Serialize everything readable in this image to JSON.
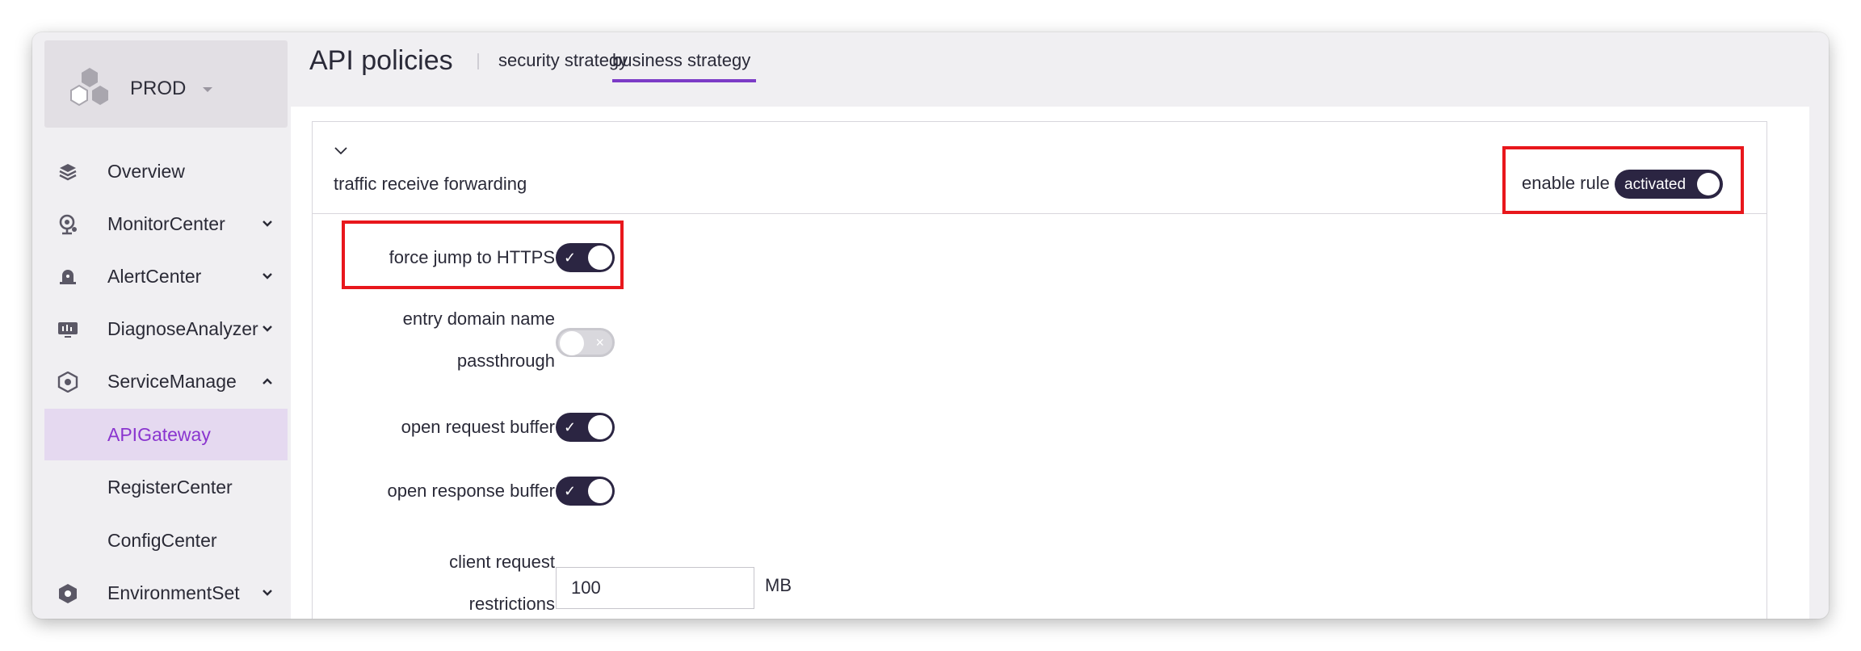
{
  "sidebar": {
    "env_name": "PROD",
    "items": [
      {
        "label": "Overview",
        "icon": "layers-icon"
      },
      {
        "label": "MonitorCenter",
        "icon": "monitor-camera-icon"
      },
      {
        "label": "AlertCenter",
        "icon": "alarm-bell-icon"
      },
      {
        "label": "DiagnoseAnalyzer",
        "icon": "analyzer-screen-icon"
      },
      {
        "label": "ServiceManage",
        "icon": "service-hex-icon"
      },
      {
        "label": "APIGateway"
      },
      {
        "label": "RegisterCenter"
      },
      {
        "label": "ConfigCenter"
      },
      {
        "label": "EnvironmentSet",
        "icon": "environment-gear-icon"
      }
    ]
  },
  "header": {
    "title": "API policies",
    "tabs": [
      {
        "label": "security strategy"
      },
      {
        "label": "business strategy",
        "active": true
      }
    ]
  },
  "rule": {
    "title": "traffic receive forwarding",
    "enable_label": "enable rule",
    "enable_state": "activated"
  },
  "form": {
    "force_https_label": "force jump to HTTPS",
    "entry_domain_label_1": "entry domain name",
    "entry_domain_label_2": "passthrough",
    "request_buffer_label": "open request buffer",
    "response_buffer_label": "open response buffer",
    "client_request_label_1": "client request",
    "client_request_label_2": "restrictions",
    "client_request_value": "100",
    "client_request_unit": "MB",
    "switch_on_mark": "✓",
    "switch_off_mark": "×"
  },
  "colors": {
    "accent": "#7c3bc7",
    "active_nav_bg": "#e5d9f0",
    "switch_on": "#2b2542",
    "highlight_box": "#e8171c"
  }
}
